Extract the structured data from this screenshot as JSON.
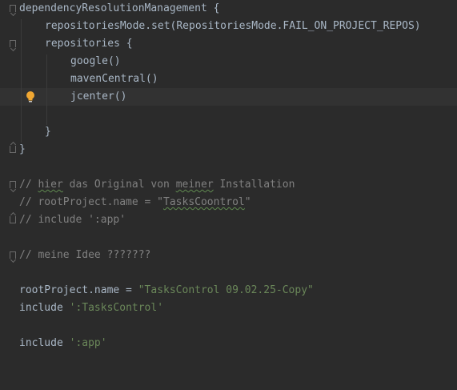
{
  "editor": {
    "lines": {
      "l1": "dependencyResolutionManagement {",
      "l2": "repositoriesMode.set(RepositoriesMode.FAIL_ON_PROJECT_REPOS)",
      "l3": "repositories {",
      "l4": "google()",
      "l5": "mavenCentral()",
      "l6": "jcenter()",
      "l8": "}",
      "l9": "}",
      "c1_a": "// ",
      "c1_b": "hier",
      "c1_c": " das Original von ",
      "c1_d": "meiner",
      "c1_e": " Installation",
      "c2_a": "// rootProject.name = \"",
      "c2_b": "TasksCoontrol",
      "c2_c": "\"",
      "c3": "// include ':app'",
      "c4": "// meine Idee ???????",
      "r1_a": "rootProject.name = ",
      "r1_b": "\"TasksControl 09.02.25-Copy\"",
      "r2_a": "include ",
      "r2_b": "':TasksControl'",
      "r3_a": "include ",
      "r3_b": "':app'"
    },
    "icons": {
      "fold": "fold-marker-icon",
      "intention": "lightbulb-icon"
    },
    "colors": {
      "background": "#2b2b2b",
      "text": "#a9b7c6",
      "string": "#6a8759",
      "comment": "#808080",
      "intention_bulb": "#f0a732"
    }
  }
}
